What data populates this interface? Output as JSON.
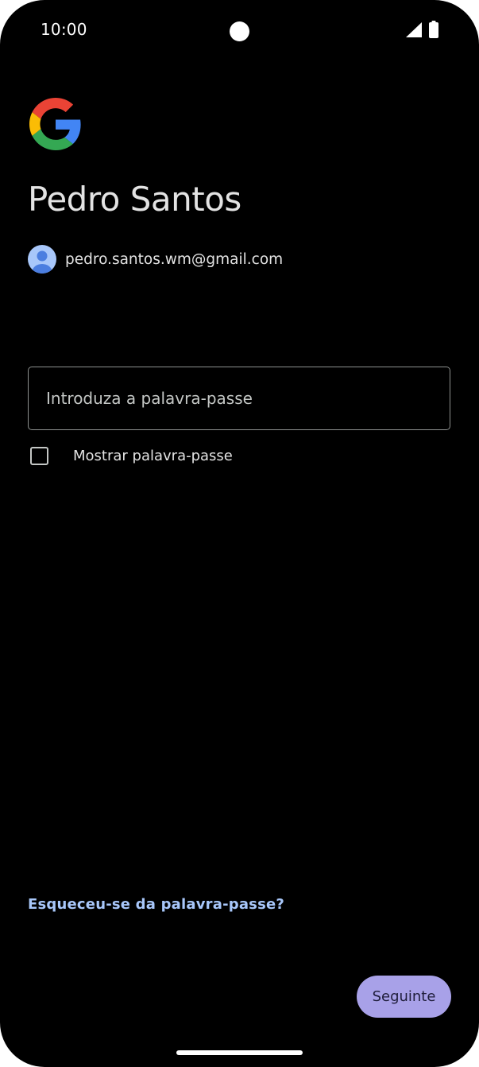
{
  "status_bar": {
    "time": "10:00",
    "icons": [
      "signal-icon",
      "battery-icon"
    ]
  },
  "brand": {
    "logo": "google-logo-icon",
    "colors": {
      "blue": "#4285F4",
      "red": "#EA4335",
      "yellow": "#FBBC05",
      "green": "#34A853"
    }
  },
  "account": {
    "name": "Pedro Santos",
    "email": "pedro.santos.wm@gmail.com",
    "avatar_icon": "account-avatar-icon"
  },
  "password": {
    "value": "",
    "placeholder": "Introduza a palavra-passe"
  },
  "show_password": {
    "label": "Mostrar palavra-passe",
    "checked": false
  },
  "forgot_password": {
    "label": "Esqueceu-se da palavra-passe?"
  },
  "next_button": {
    "label": "Seguinte"
  },
  "theme": {
    "background": "#000000",
    "text": "#e3e3e3",
    "link": "#a8c7fa",
    "primary_button": "#a8a1e8"
  }
}
